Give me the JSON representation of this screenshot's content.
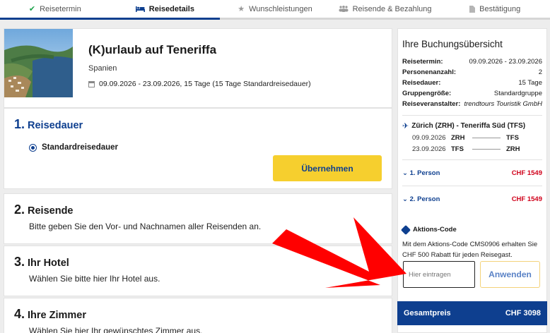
{
  "stepper": {
    "steps": [
      {
        "label": "Reisetermin",
        "icon": "checkmark-icon",
        "state": "done"
      },
      {
        "label": "Reisedetails",
        "icon": "bed-icon",
        "state": "active"
      },
      {
        "label": "Wunschleistungen",
        "icon": "star-icon",
        "state": "pending"
      },
      {
        "label": "Reisende & Bezahlung",
        "icon": "people-icon",
        "state": "pending"
      },
      {
        "label": "Bestätigung",
        "icon": "document-icon",
        "state": "pending"
      }
    ],
    "progress": 0.4
  },
  "trip": {
    "title": "(K)urlaub auf Teneriffa",
    "country": "Spanien",
    "dates": "09.09.2026 - 23.09.2026, 15 Tage (15 Tage Standardreisedauer)"
  },
  "sections": {
    "reisedauer": {
      "num": "1.",
      "title": "Reisedauer",
      "option": "Standardreisedauer",
      "button": "Übernehmen"
    },
    "reisende": {
      "num": "2.",
      "title": "Reisende",
      "desc": "Bitte geben Sie den Vor- und Nachnamen aller Reisenden an."
    },
    "hotel": {
      "num": "3.",
      "title": "Ihr Hotel",
      "desc": "Wählen Sie bitte hier Ihr Hotel aus."
    },
    "zimmer": {
      "num": "4.",
      "title": "Ihre Zimmer",
      "desc": "Wählen Sie hier Ihr gewünschtes Zimmer aus."
    }
  },
  "summary": {
    "title": "Ihre Buchungsübersicht",
    "rows": [
      {
        "k": "Reisetermin:",
        "v": "09.09.2026 - 23.09.2026"
      },
      {
        "k": "Personenanzahl:",
        "v": "2"
      },
      {
        "k": "Reisedauer:",
        "v": "15 Tage"
      },
      {
        "k": "Gruppengröße:",
        "v": "Standardgruppe"
      },
      {
        "k": "Reiseveranstalter:",
        "v": "trendtours Touristik GmbH"
      }
    ],
    "flight": {
      "route": "Zürich (ZRH) - Teneriffa Süd (TFS)",
      "legs": [
        {
          "date": "09.09.2026",
          "from": "ZRH",
          "to": "TFS"
        },
        {
          "date": "23.09.2026",
          "from": "TFS",
          "to": "ZRH"
        }
      ]
    },
    "persons": [
      {
        "label": "1. Person",
        "price": "CHF 1549"
      },
      {
        "label": "2. Person",
        "price": "CHF 1549"
      }
    ],
    "promo": {
      "title": "Aktions-Code",
      "text": "Mit dem Aktions-Code CMS0906 erhalten Sie CHF 500 Rabatt für jeden Reisegast.",
      "placeholder": "Hier eintragen",
      "button": "Anwenden"
    },
    "total": {
      "label": "Gesamtpreis",
      "value": "CHF 3098"
    }
  },
  "colors": {
    "brand": "#0e3f8f",
    "accent": "#f6cf2e",
    "price": "#d0021b",
    "arrow": "#ff0000"
  }
}
